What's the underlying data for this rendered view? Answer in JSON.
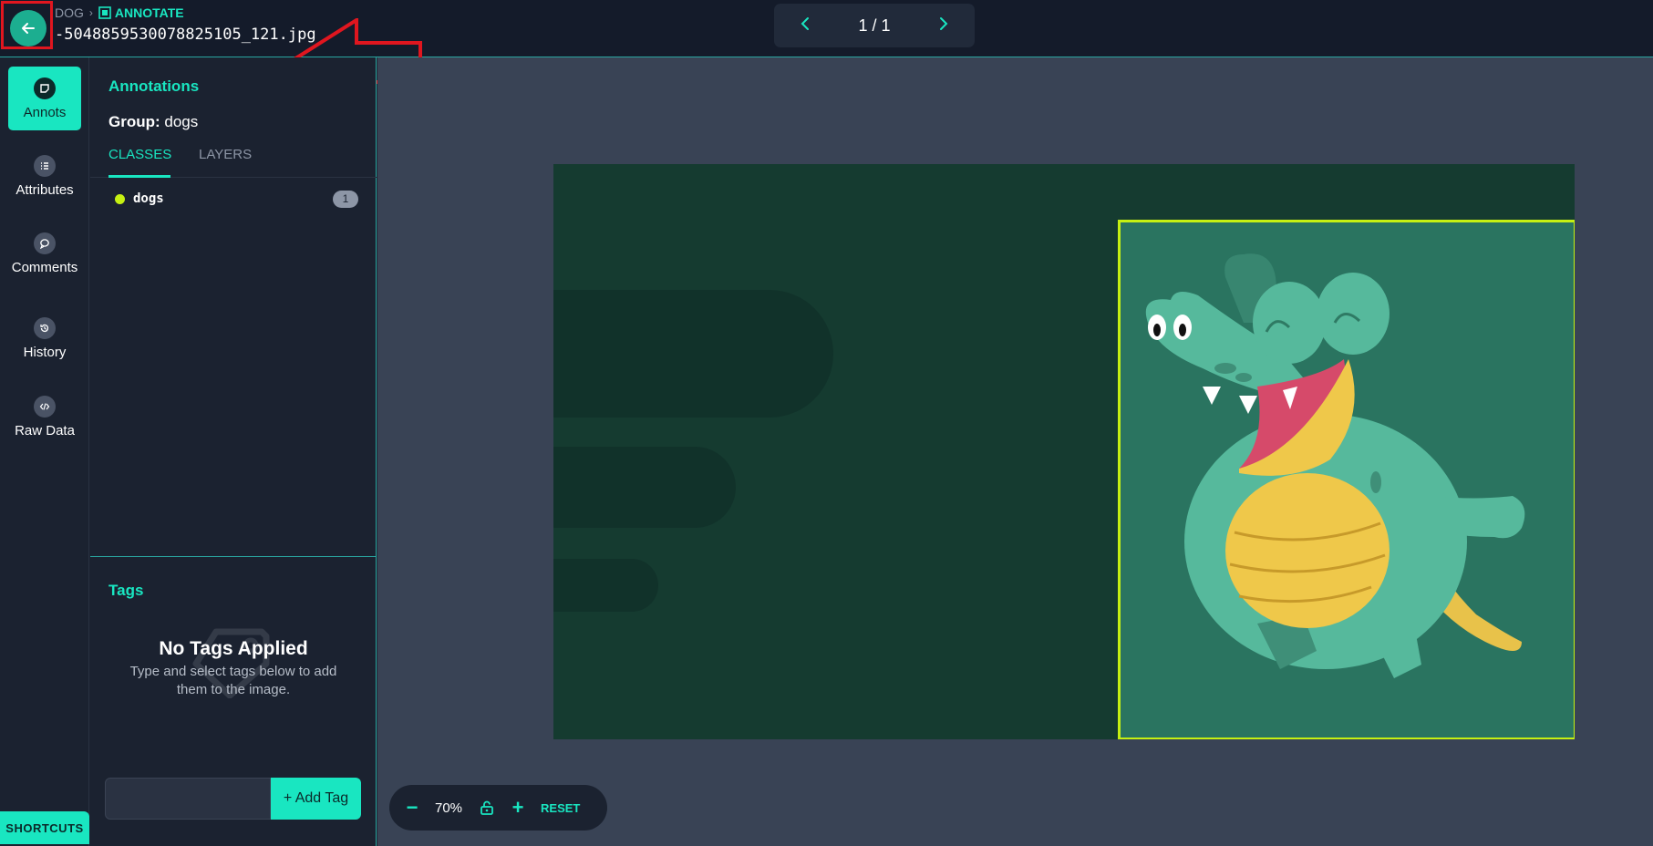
{
  "header": {
    "breadcrumb_dataset": "DOG",
    "breadcrumb_mode": "ANNOTATE",
    "filename": "-5048859530078825105_121.jpg",
    "pager_text": "1 / 1"
  },
  "nav": {
    "items": [
      {
        "label": "Annots",
        "icon": "note-icon",
        "active": true
      },
      {
        "label": "Attributes",
        "icon": "list-icon"
      },
      {
        "label": "Comments",
        "icon": "comment-icon"
      },
      {
        "label": "History",
        "icon": "history-icon"
      },
      {
        "label": "Raw Data",
        "icon": "code-icon"
      }
    ],
    "shortcuts_label": "SHORTCUTS"
  },
  "panel": {
    "title": "Annotations",
    "group_label": "Group:",
    "group_value": "dogs",
    "tabs": [
      "CLASSES",
      "LAYERS"
    ],
    "classes": [
      {
        "name": "dogs",
        "count": "1",
        "color": "#c6f012"
      }
    ],
    "tags_title": "Tags",
    "no_tags_title": "No Tags Applied",
    "no_tags_sub": "Type and select tags below to add them to the image.",
    "add_tag_label": "+ Add Tag"
  },
  "canvas": {
    "zoom": "70%",
    "reset_label": "RESET"
  },
  "colors": {
    "accent": "#19e6c1",
    "bbox": "#c6f012",
    "highlight": "#e0161f"
  }
}
